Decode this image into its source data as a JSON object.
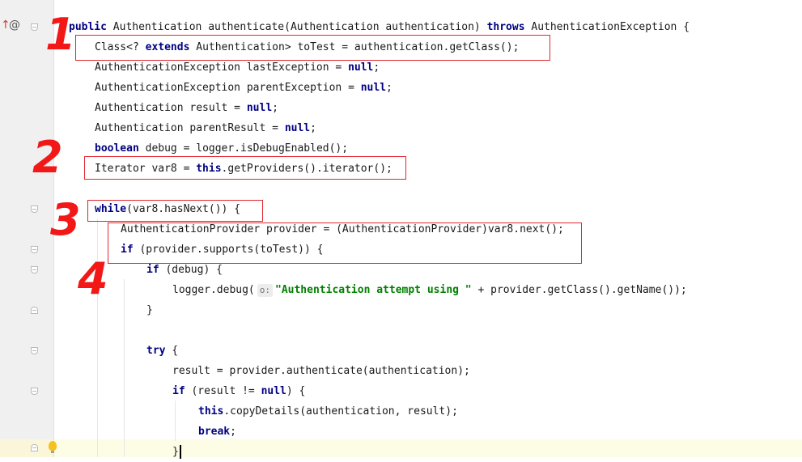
{
  "gutter": {
    "override_marker": "↑",
    "annotation_marker": "@"
  },
  "code_lines": [
    {
      "id": "l1",
      "segments": [
        {
          "t": "public",
          "k": "kw"
        },
        {
          "t": " Authentication authenticate(Authentication authentication) "
        },
        {
          "t": "throws",
          "k": "kw"
        },
        {
          "t": " AuthenticationException {"
        }
      ]
    },
    {
      "id": "l2",
      "segments": [
        {
          "t": "Class<? "
        },
        {
          "t": "extends",
          "k": "kw"
        },
        {
          "t": " Authentication> toTest = authentication.getClass();"
        }
      ]
    },
    {
      "id": "l3",
      "segments": [
        {
          "t": "AuthenticationException lastException = "
        },
        {
          "t": "null",
          "k": "kw"
        },
        {
          "t": ";"
        }
      ]
    },
    {
      "id": "l4",
      "segments": [
        {
          "t": "AuthenticationException parentException = "
        },
        {
          "t": "null",
          "k": "kw"
        },
        {
          "t": ";"
        }
      ]
    },
    {
      "id": "l5",
      "segments": [
        {
          "t": "Authentication result = "
        },
        {
          "t": "null",
          "k": "kw"
        },
        {
          "t": ";"
        }
      ]
    },
    {
      "id": "l6",
      "segments": [
        {
          "t": "Authentication parentResult = "
        },
        {
          "t": "null",
          "k": "kw"
        },
        {
          "t": ";"
        }
      ]
    },
    {
      "id": "l7",
      "segments": [
        {
          "t": "boolean",
          "k": "kw"
        },
        {
          "t": " debug = logger.isDebugEnabled();"
        }
      ]
    },
    {
      "id": "l8",
      "segments": [
        {
          "t": "Iterator var8 = "
        },
        {
          "t": "this",
          "k": "kw"
        },
        {
          "t": ".getProviders().iterator();"
        }
      ]
    },
    {
      "id": "l9",
      "segments": []
    },
    {
      "id": "l10",
      "segments": [
        {
          "t": "while",
          "k": "kw"
        },
        {
          "t": "(var8.hasNext()) {"
        }
      ]
    },
    {
      "id": "l11",
      "segments": [
        {
          "t": "AuthenticationProvider provider = (AuthenticationProvider)var8.next();"
        }
      ]
    },
    {
      "id": "l12",
      "segments": [
        {
          "t": "if",
          "k": "kw"
        },
        {
          "t": " (provider.supports(toTest)) {"
        }
      ]
    },
    {
      "id": "l13",
      "segments": [
        {
          "t": "if",
          "k": "kw"
        },
        {
          "t": " (debug) {"
        }
      ]
    },
    {
      "id": "l14",
      "segments": [
        {
          "t": "logger.debug("
        },
        {
          "t": "o:",
          "k": "hint"
        },
        {
          "t": "\"Authentication attempt using \"",
          "k": "str"
        },
        {
          "t": " + provider.getClass().getName());"
        }
      ]
    },
    {
      "id": "l15",
      "segments": [
        {
          "t": "}"
        }
      ]
    },
    {
      "id": "l16",
      "segments": []
    },
    {
      "id": "l17",
      "segments": [
        {
          "t": "try",
          "k": "kw"
        },
        {
          "t": " {"
        }
      ]
    },
    {
      "id": "l18",
      "segments": [
        {
          "t": "result = provider.authenticate(authentication);"
        }
      ]
    },
    {
      "id": "l19",
      "segments": [
        {
          "t": "if",
          "k": "kw"
        },
        {
          "t": " (result != "
        },
        {
          "t": "null",
          "k": "kw"
        },
        {
          "t": ") {"
        }
      ]
    },
    {
      "id": "l20",
      "segments": [
        {
          "t": "this",
          "k": "kw"
        },
        {
          "t": ".copyDetails(authentication, result);"
        }
      ]
    },
    {
      "id": "l21",
      "segments": [
        {
          "t": "break",
          "k": "kw"
        },
        {
          "t": ";"
        }
      ]
    },
    {
      "id": "l22",
      "segments": [
        {
          "t": "}"
        }
      ]
    }
  ],
  "annotations": [
    {
      "id": "mark-1",
      "number": "1"
    },
    {
      "id": "mark-2",
      "number": "2"
    },
    {
      "id": "mark-3",
      "number": "3"
    },
    {
      "id": "mark-4",
      "number": "4"
    }
  ],
  "colors": {
    "keyword": "#000080",
    "string": "#008000",
    "annotation_red": "#e0262e",
    "current_line": "#fdfce5"
  }
}
